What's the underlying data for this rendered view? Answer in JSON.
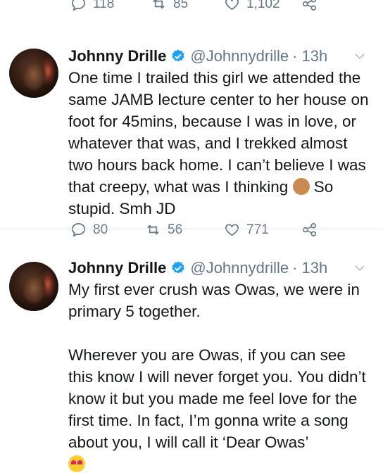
{
  "top_actions": {
    "replies": "118",
    "retweets": "85",
    "likes": "1,102"
  },
  "tweets": [
    {
      "name": "Johnny Drille",
      "handle": "@Johnnydrille",
      "time": "· 13h",
      "text_before_emoji": "One time I trailed this girl we attended the same JAMB lecture center to her house on foot for 45mins, because I was in love, or whatever that was, and I trekked almost two hours back home. I can’t believe I was that creepy, what was I thinking ",
      "text_after_emoji": " So stupid. Smh JD",
      "emoji": "facepalm-emoji",
      "replies": "80",
      "retweets": "56",
      "likes": "771"
    },
    {
      "name": "Johnny Drille",
      "handle": "@Johnnydrille",
      "time": "· 13h",
      "para1": "My first ever crush was Owas, we were in primary 5 together.",
      "para2": "Wherever you are Owas, if you can see this know I will never forget you. You didn’t know it but you made me feel love for the first time. In fact, I’m gonna write a song about you, I will call it ‘Dear Owas’",
      "emoji": "heart-eyes-emoji"
    }
  ],
  "colors": {
    "text": "#14171a",
    "muted": "#657786",
    "verified": "#1da1f2",
    "divider": "#e1e8ed"
  }
}
